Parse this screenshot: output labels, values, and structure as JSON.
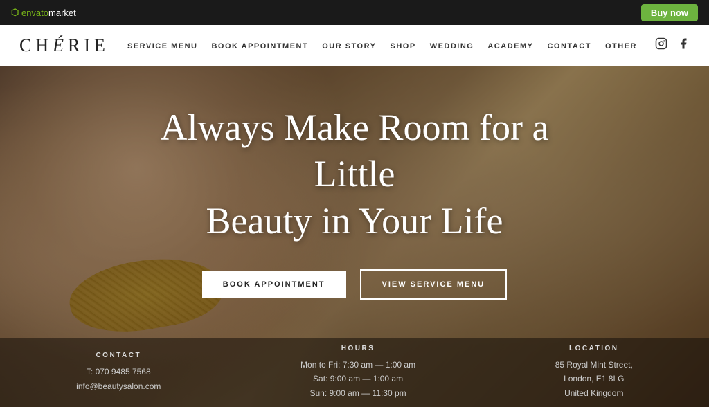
{
  "envato": {
    "logo_envato": "envato",
    "logo_market": "market",
    "buy_now": "Buy now"
  },
  "navbar": {
    "brand": "CHÉRIE",
    "links": [
      {
        "id": "service-menu",
        "label": "SERVICE MENU"
      },
      {
        "id": "book-appointment",
        "label": "BOOK APPOINTMENT"
      },
      {
        "id": "our-story",
        "label": "OUR STORY"
      },
      {
        "id": "shop",
        "label": "SHOP"
      },
      {
        "id": "wedding",
        "label": "WEDDING"
      },
      {
        "id": "academy",
        "label": "ACADEMY"
      },
      {
        "id": "contact",
        "label": "CONTACT"
      },
      {
        "id": "other",
        "label": "OTHER"
      }
    ]
  },
  "hero": {
    "title_line1": "Always Make Room for a Little",
    "title_line2": "Beauty in Your Life",
    "btn_primary": "BOOK APPOINTMENT",
    "btn_secondary": "VIEW SERVICE MENU"
  },
  "info": {
    "contact": {
      "heading": "CONTACT",
      "phone": "T: 070 9485 7568",
      "email": "info@beautysalon.com"
    },
    "hours": {
      "heading": "HOURS",
      "line1": "Mon to Fri: 7:30 am — 1:00 am",
      "line2": "Sat: 9:00 am — 1:00 am",
      "line3": "Sun: 9:00 am — 11:30 pm"
    },
    "location": {
      "heading": "LOCATION",
      "line1": "85 Royal Mint Street,",
      "line2": "London, E1 8LG",
      "line3": "United Kingdom"
    }
  }
}
